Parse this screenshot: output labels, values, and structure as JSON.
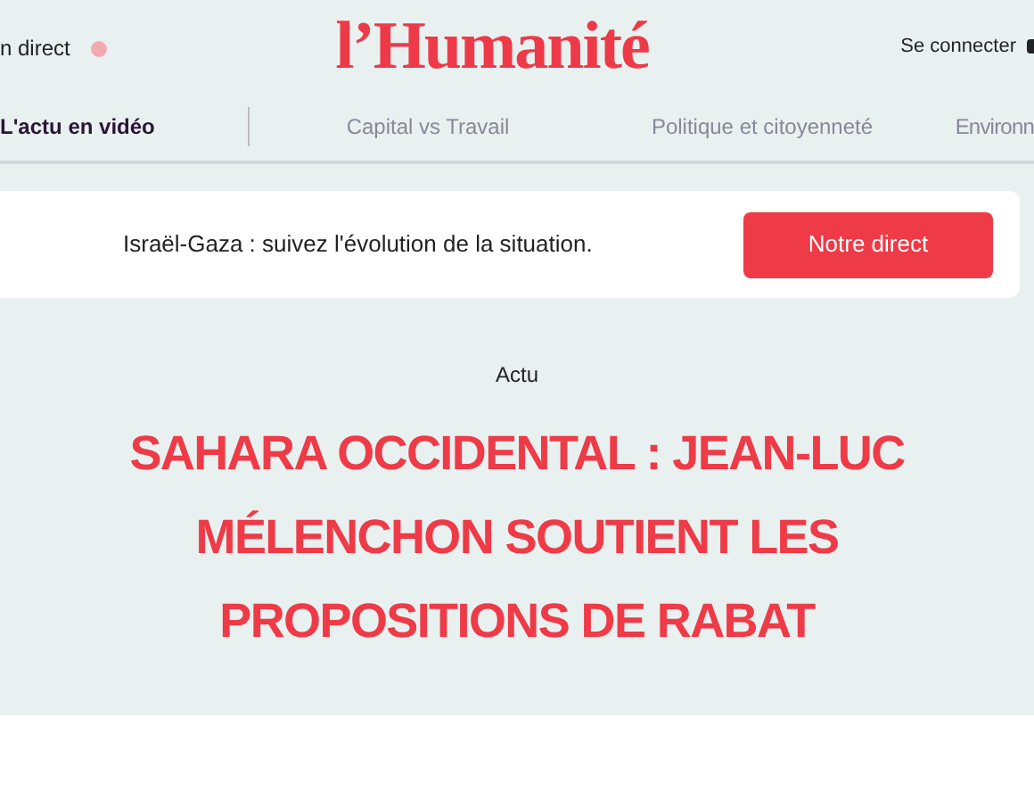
{
  "header": {
    "live_label": "n direct",
    "logo": "l’Humanité",
    "login": "Se connecter"
  },
  "nav": [
    {
      "label": "L'actu en vidéo",
      "selected": true
    },
    {
      "label": "Capital vs Travail",
      "selected": false
    },
    {
      "label": "Politique et citoyenneté",
      "selected": false
    },
    {
      "label": "Environn",
      "selected": false
    }
  ],
  "banner": {
    "text": "Israël-Gaza : suivez l'évolution de la situation.",
    "button": "Notre direct"
  },
  "article": {
    "category": "Actu",
    "title": "SAHARA OCCIDENTAL : JEAN-LUC MÉLENCHON SOUTIENT LES PROPOSITIONS DE RABAT"
  }
}
